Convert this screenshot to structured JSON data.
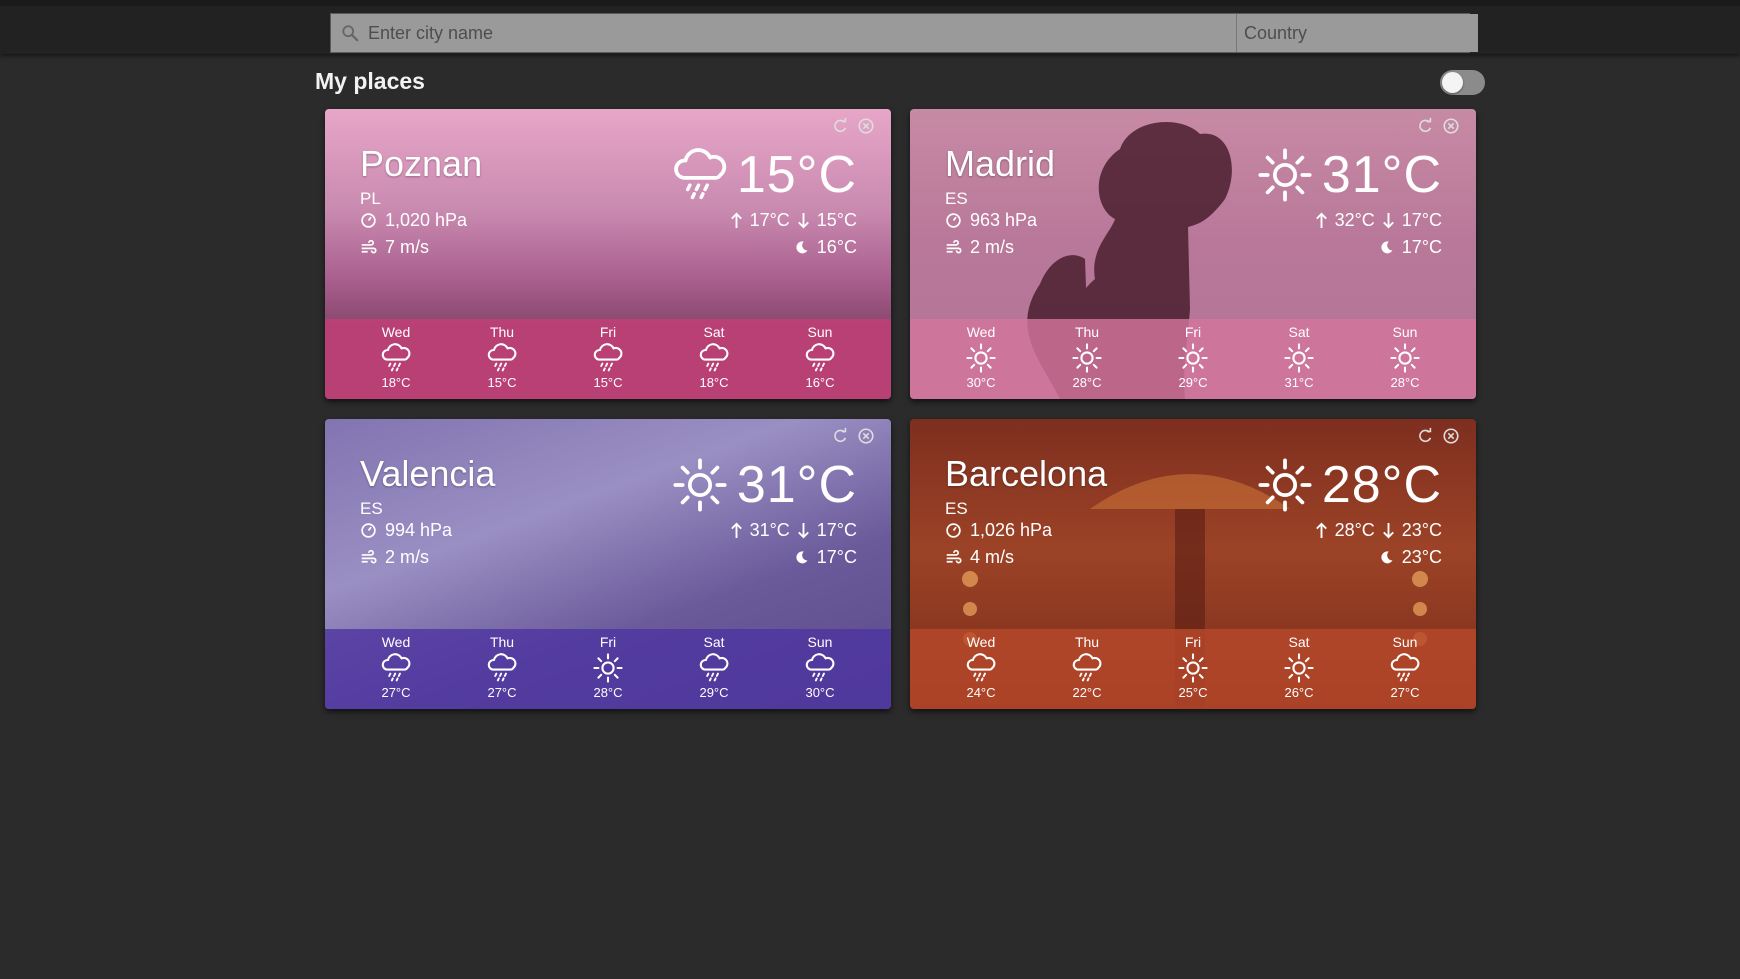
{
  "search": {
    "city_placeholder": "Enter city name",
    "country_placeholder": "Country",
    "icon": "search-icon"
  },
  "heading": "My places",
  "toggle": {
    "on": false
  },
  "colors": {
    "page_bg": "#2b2b2b",
    "topbar_bg": "#222222",
    "input_bg": "#9a9a9a"
  },
  "cards": [
    {
      "city": "Poznan",
      "country": "PL",
      "pressure": "1,020 hPa",
      "wind": "7 m/s",
      "temp": "15°C",
      "icon": "rain-cloud-icon",
      "high": "17°C",
      "low": "15°C",
      "night": "16°C",
      "tint": "#d46f9c",
      "band": "#c63e78",
      "forecast": [
        {
          "day": "Wed",
          "temp": "18°C",
          "icon": "rain-cloud-icon"
        },
        {
          "day": "Thu",
          "temp": "15°C",
          "icon": "rain-cloud-icon"
        },
        {
          "day": "Fri",
          "temp": "15°C",
          "icon": "rain-cloud-icon"
        },
        {
          "day": "Sat",
          "temp": "18°C",
          "icon": "rain-cloud-icon"
        },
        {
          "day": "Sun",
          "temp": "16°C",
          "icon": "rain-cloud-icon"
        }
      ]
    },
    {
      "city": "Madrid",
      "country": "ES",
      "pressure": "963 hPa",
      "wind": "2 m/s",
      "temp": "31°C",
      "icon": "sun-icon",
      "high": "32°C",
      "low": "17°C",
      "night": "17°C",
      "tint": "#b8607f",
      "band": "#d5769c",
      "forecast": [
        {
          "day": "Wed",
          "temp": "30°C",
          "icon": "sun-icon"
        },
        {
          "day": "Thu",
          "temp": "28°C",
          "icon": "sun-icon"
        },
        {
          "day": "Fri",
          "temp": "29°C",
          "icon": "sun-icon"
        },
        {
          "day": "Sat",
          "temp": "31°C",
          "icon": "sun-icon"
        },
        {
          "day": "Sun",
          "temp": "28°C",
          "icon": "sun-icon"
        }
      ]
    },
    {
      "city": "Valencia",
      "country": "ES",
      "pressure": "994 hPa",
      "wind": "2 m/s",
      "temp": "31°C",
      "icon": "sun-icon",
      "high": "31°C",
      "low": "17°C",
      "night": "17°C",
      "tint": "#6d5d98",
      "band": "#4d34a0",
      "forecast": [
        {
          "day": "Wed",
          "temp": "27°C",
          "icon": "rain-cloud-icon"
        },
        {
          "day": "Thu",
          "temp": "27°C",
          "icon": "rain-cloud-icon"
        },
        {
          "day": "Fri",
          "temp": "28°C",
          "icon": "sun-icon"
        },
        {
          "day": "Sat",
          "temp": "29°C",
          "icon": "rain-cloud-icon"
        },
        {
          "day": "Sun",
          "temp": "30°C",
          "icon": "rain-cloud-icon"
        }
      ]
    },
    {
      "city": "Barcelona",
      "country": "ES",
      "pressure": "1,026 hPa",
      "wind": "4 m/s",
      "temp": "28°C",
      "icon": "sun-icon",
      "high": "28°C",
      "low": "23°C",
      "night": "23°C",
      "tint": "#8b3522",
      "band": "#b8482a",
      "forecast": [
        {
          "day": "Wed",
          "temp": "24°C",
          "icon": "rain-cloud-icon"
        },
        {
          "day": "Thu",
          "temp": "22°C",
          "icon": "rain-cloud-icon"
        },
        {
          "day": "Fri",
          "temp": "25°C",
          "icon": "sun-icon"
        },
        {
          "day": "Sat",
          "temp": "26°C",
          "icon": "sun-icon"
        },
        {
          "day": "Sun",
          "temp": "27°C",
          "icon": "rain-cloud-icon"
        }
      ]
    }
  ]
}
